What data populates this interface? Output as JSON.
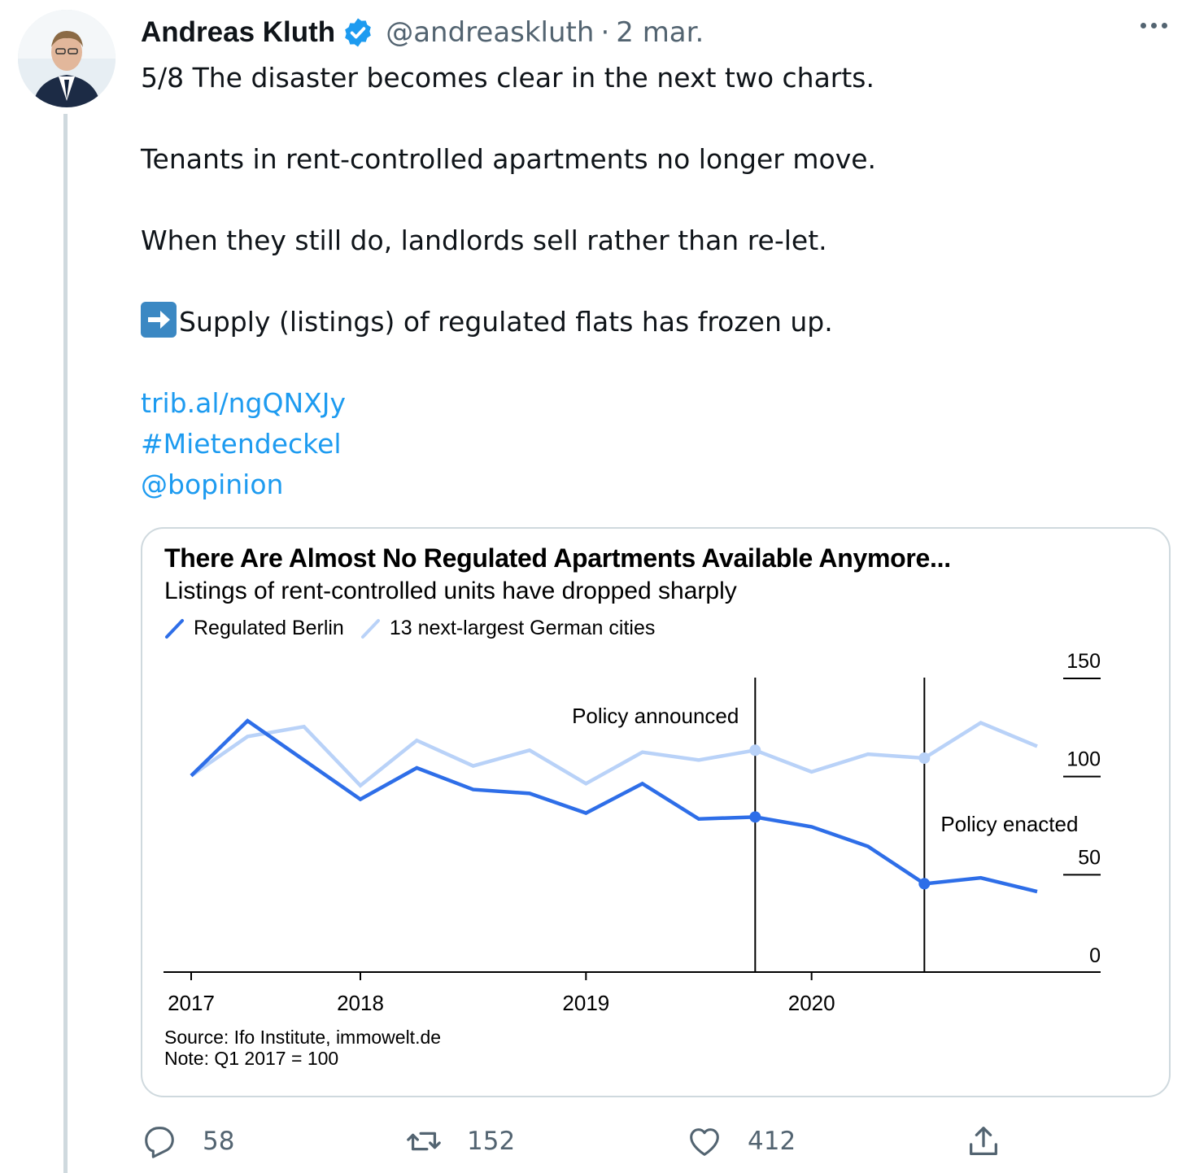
{
  "author": {
    "name": "Andreas Kluth",
    "handle": "@andreaskluth",
    "separator": "·",
    "date": "2 mar."
  },
  "tweet": {
    "lines": [
      "5/8 The disaster becomes clear in the next two charts.",
      "Tenants in rent-controlled apartments no longer move.",
      "When they still do, landlords sell rather than re-let.",
      "Supply (listings) of regulated flats has frozen up."
    ],
    "link": "trib.al/ngQNXJy",
    "hashtag": "#Mietendeckel",
    "mention": "@bopinion"
  },
  "media": {
    "chart_data": {
      "type": "line",
      "title": "There Are Almost No Regulated Apartments Available Anymore...",
      "subtitle": "Listings of rent-controlled units have dropped sharply",
      "x_tick_labels": [
        "2017",
        "2018",
        "2019",
        "2020"
      ],
      "x_ticks": [
        2017.0,
        2017.75,
        2018.75,
        2019.75
      ],
      "ylim": [
        0,
        150
      ],
      "y_ticks": [
        150,
        100,
        50,
        0
      ],
      "y_axis_side": "right",
      "x": [
        2017.0,
        2017.25,
        2017.5,
        2017.75,
        2018.0,
        2018.25,
        2018.5,
        2018.75,
        2019.0,
        2019.25,
        2019.5,
        2019.75,
        2020.0,
        2020.25,
        2020.5,
        2020.75
      ],
      "series": [
        {
          "name": "Regulated Berlin",
          "color": "#2e6ee8",
          "values": [
            100,
            128,
            108,
            88,
            104,
            93,
            91,
            81,
            96,
            78,
            79,
            74,
            64,
            45,
            48,
            41
          ]
        },
        {
          "name": "13 next-largest German cities",
          "color": "#b9d2f8",
          "values": [
            100,
            120,
            125,
            95,
            118,
            105,
            113,
            96,
            112,
            108,
            113,
            102,
            111,
            109,
            127,
            115
          ]
        }
      ],
      "highlighted_points": [
        {
          "series": "Regulated Berlin",
          "x": 2019.5
        },
        {
          "series": "Regulated Berlin",
          "x": 2020.25
        },
        {
          "series": "13 next-largest German cities",
          "x": 2019.5
        },
        {
          "series": "13 next-largest German cities",
          "x": 2020.25
        }
      ],
      "annotations": [
        {
          "text": "Policy announced",
          "x": 2019.5
        },
        {
          "text": "Policy enacted",
          "x": 2020.25
        }
      ],
      "legend_position": "top-left",
      "grid": false,
      "source": "Source: Ifo Institute, immowelt.de",
      "note": "Note: Q1 2017 = 100"
    }
  },
  "actions": {
    "reply_count": "58",
    "retweet_count": "152",
    "like_count": "412"
  },
  "colors": {
    "link": "#1d9bf0",
    "verified": "#1d9bf0",
    "secondary_text": "#536471"
  }
}
